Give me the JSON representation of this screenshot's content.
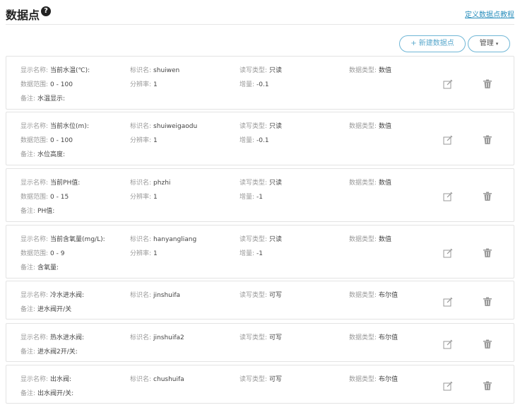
{
  "header": {
    "title": "数据点",
    "help_glyph": "?",
    "tutorial_link": "定义数据点教程"
  },
  "toolbar": {
    "new_button": "+ 新建数据点",
    "manage_button": "管理",
    "manage_caret": "▾"
  },
  "labels": {
    "display_name": "显示名称:",
    "identifier": "标识名:",
    "rw_type": "读写类型:",
    "data_type": "数据类型:",
    "range": "数据范围:",
    "resolution": "分辨率:",
    "increment": "增量:",
    "remark": "备注:"
  },
  "datapoints": [
    {
      "display_name": "当前水温(℃):",
      "identifier": "shuiwen",
      "rw_type": "只读",
      "data_type": "数值",
      "range": "0 - 100",
      "resolution": "1",
      "increment": "-0.1",
      "remark": "水温显示:"
    },
    {
      "display_name": "当前水位(m):",
      "identifier": "shuiweigaodu",
      "rw_type": "只读",
      "data_type": "数值",
      "range": "0 - 100",
      "resolution": "1",
      "increment": "-0.1",
      "remark": "水位高度:"
    },
    {
      "display_name": "当前PH值:",
      "identifier": "phzhi",
      "rw_type": "只读",
      "data_type": "数值",
      "range": "0 - 15",
      "resolution": "1",
      "increment": "-1",
      "remark": "PH值:"
    },
    {
      "display_name": "当前含氧量(mg/L):",
      "identifier": "hanyangliang",
      "rw_type": "只读",
      "data_type": "数值",
      "range": "0 - 9",
      "resolution": "1",
      "increment": "-1",
      "remark": "含氧量:"
    },
    {
      "display_name": "冷水进水阀:",
      "identifier": "jinshuifa",
      "rw_type": "可写",
      "data_type": "布尔值",
      "remark": "进水阀开/关"
    },
    {
      "display_name": "热水进水阀:",
      "identifier": "jinshuifa2",
      "rw_type": "可写",
      "data_type": "布尔值",
      "remark": "进水阀2开/关:"
    },
    {
      "display_name": "出水阀:",
      "identifier": "chushuifa",
      "rw_type": "可写",
      "data_type": "布尔值",
      "remark": "出水阀开/关:"
    }
  ],
  "icons": {
    "help": "help-circle-icon",
    "edit": "edit-icon",
    "delete": "trash-icon"
  }
}
